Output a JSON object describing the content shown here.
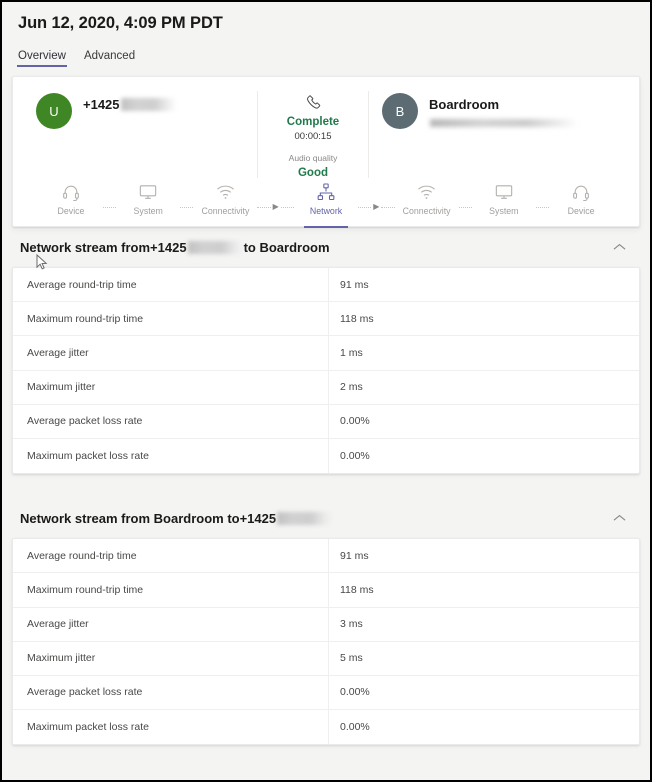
{
  "header": {
    "title": "Jun 12, 2020, 4:09 PM PDT",
    "tabs": [
      {
        "label": "Overview",
        "active": true
      },
      {
        "label": "Advanced",
        "active": false
      }
    ]
  },
  "call_summary": {
    "caller": {
      "avatar_initial": "U",
      "avatar_color": "#3f8624",
      "name": "+1425",
      "name_redacted": true
    },
    "callee": {
      "avatar_initial": "B",
      "avatar_color": "#5d6b73",
      "name": "Boardroom",
      "email_redacted": true
    },
    "status": {
      "icon": "phone-icon",
      "state": "Complete",
      "state_color": "#217a4b",
      "duration": "00:00:15",
      "quality_label": "Audio quality",
      "quality_value": "Good",
      "quality_color": "#217a4b"
    },
    "flow": {
      "accent_color": "#6264a7",
      "steps": [
        {
          "label": "Device",
          "icon": "headset-icon",
          "active": false
        },
        {
          "label": "System",
          "icon": "monitor-icon",
          "active": false
        },
        {
          "label": "Connectivity",
          "icon": "wifi-icon",
          "active": false
        },
        {
          "label": "Network",
          "icon": "network-topology-icon",
          "active": true
        },
        {
          "label": "Connectivity",
          "icon": "wifi-icon",
          "active": false
        },
        {
          "label": "System",
          "icon": "monitor-icon",
          "active": false
        },
        {
          "label": "Device",
          "icon": "headset-icon",
          "active": false
        }
      ],
      "arrow_glyph": "▶"
    }
  },
  "sections": [
    {
      "title_prefix": "Network stream from ",
      "title_redacted_token": "+1425",
      "title_suffix": " to Boardroom",
      "redact_position": "middle",
      "collapse_icon": "chevron-up-icon",
      "rows": [
        {
          "label": "Average round-trip time",
          "value": "91 ms"
        },
        {
          "label": "Maximum round-trip time",
          "value": "118 ms"
        },
        {
          "label": "Average jitter",
          "value": "1 ms"
        },
        {
          "label": "Maximum jitter",
          "value": "2 ms"
        },
        {
          "label": "Average packet loss rate",
          "value": "0.00%"
        },
        {
          "label": "Maximum packet loss rate",
          "value": "0.00%"
        }
      ]
    },
    {
      "title_prefix": "Network stream from Boardroom to ",
      "title_redacted_token": "+1425",
      "title_suffix": "",
      "redact_position": "end",
      "collapse_icon": "chevron-up-icon",
      "rows": [
        {
          "label": "Average round-trip time",
          "value": "91 ms"
        },
        {
          "label": "Maximum round-trip time",
          "value": "118 ms"
        },
        {
          "label": "Average jitter",
          "value": "3 ms"
        },
        {
          "label": "Maximum jitter",
          "value": "5 ms"
        },
        {
          "label": "Average packet loss rate",
          "value": "0.00%"
        },
        {
          "label": "Maximum packet loss rate",
          "value": "0.00%"
        }
      ]
    }
  ]
}
